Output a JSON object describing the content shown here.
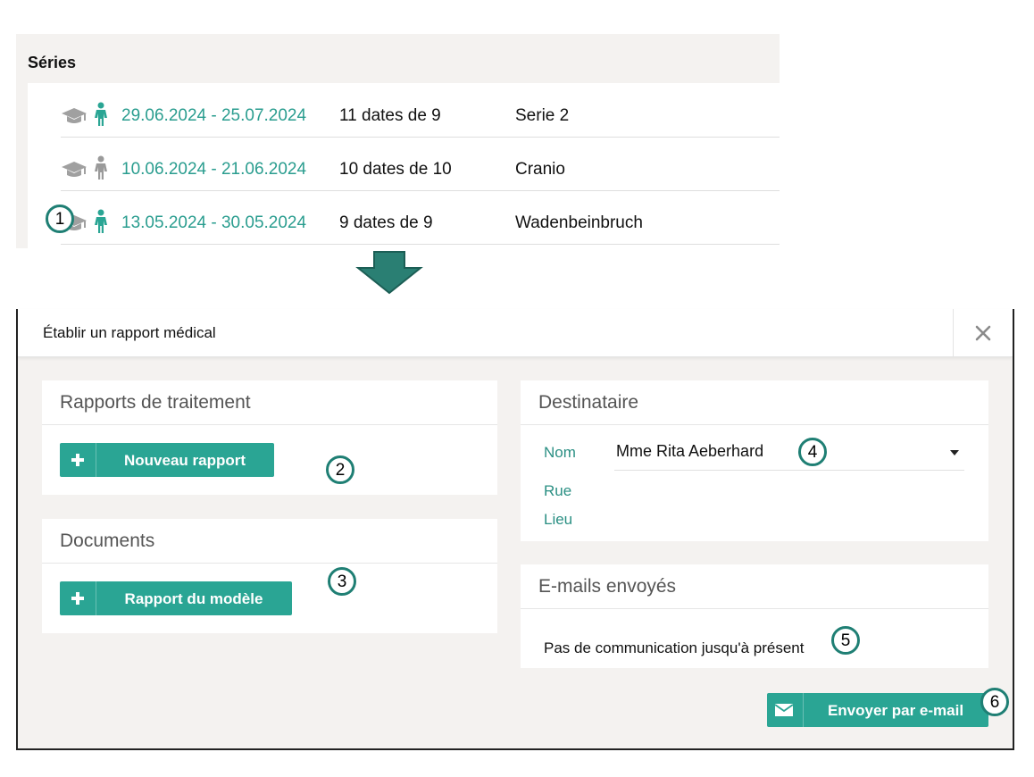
{
  "series": {
    "title": "Séries",
    "rows": [
      {
        "dates": "29.06.2024 - 25.07.2024",
        "count": "11 dates de 9",
        "name": "Serie 2",
        "person_icon_color": "#2aa594"
      },
      {
        "dates": "10.06.2024 - 21.06.2024",
        "count": "10 dates de 10",
        "name": "Cranio",
        "person_icon_color": "#9a9a9a"
      },
      {
        "dates": "13.05.2024 - 30.05.2024",
        "count": "9 dates de 9",
        "name": "Wadenbeinbruch",
        "person_icon_color": "#2aa594"
      }
    ],
    "icons": [
      "graduation-cap-icon",
      "person-icon"
    ]
  },
  "dialog": {
    "title": "Établir un rapport médical",
    "close_icon": "close-icon",
    "reports": {
      "title": "Rapports de traitement",
      "new_button": "Nouveau rapport"
    },
    "documents": {
      "title": "Documents",
      "template_button": "Rapport du modèle"
    },
    "recipient": {
      "title": "Destinataire",
      "name_label": "Nom",
      "name_value": "Mme Rita Aeberhard",
      "street_label": "Rue",
      "place_label": "Lieu"
    },
    "emails": {
      "title": "E-mails envoyés",
      "empty": "Pas de communication jusqu'à présent"
    },
    "send_button": "Envoyer par e-mail"
  },
  "callouts": [
    "1",
    "2",
    "3",
    "4",
    "5",
    "6"
  ],
  "colors": {
    "accent": "#2aa594",
    "accent_dark": "#1f7f74",
    "panel_bg": "#f4f2f0"
  }
}
